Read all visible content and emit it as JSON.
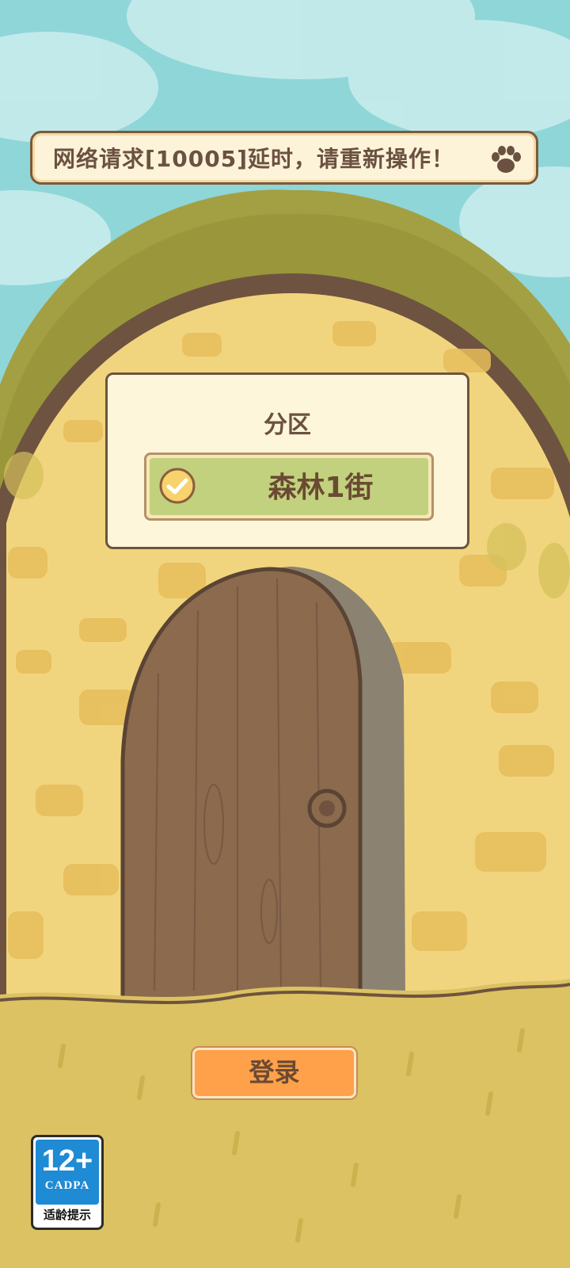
{
  "toast": {
    "message": "网络请求[10005]延时，请重新操作！",
    "icon": "paw-icon"
  },
  "server_panel": {
    "title": "分区",
    "selected_server": "森林1街",
    "selected_icon": "check-circle-icon"
  },
  "login_button": {
    "label": "登录"
  },
  "age_rating": {
    "age": "12+",
    "org": "CADPA",
    "caption": "适龄提示"
  },
  "colors": {
    "sky": "#8fd6d8",
    "wall": "#f1d57e",
    "vines": "#a3a043",
    "door": "#8b6a4d",
    "grass": "#dcc262",
    "login": "#ffa14a",
    "server_selected": "#c2d17e"
  }
}
